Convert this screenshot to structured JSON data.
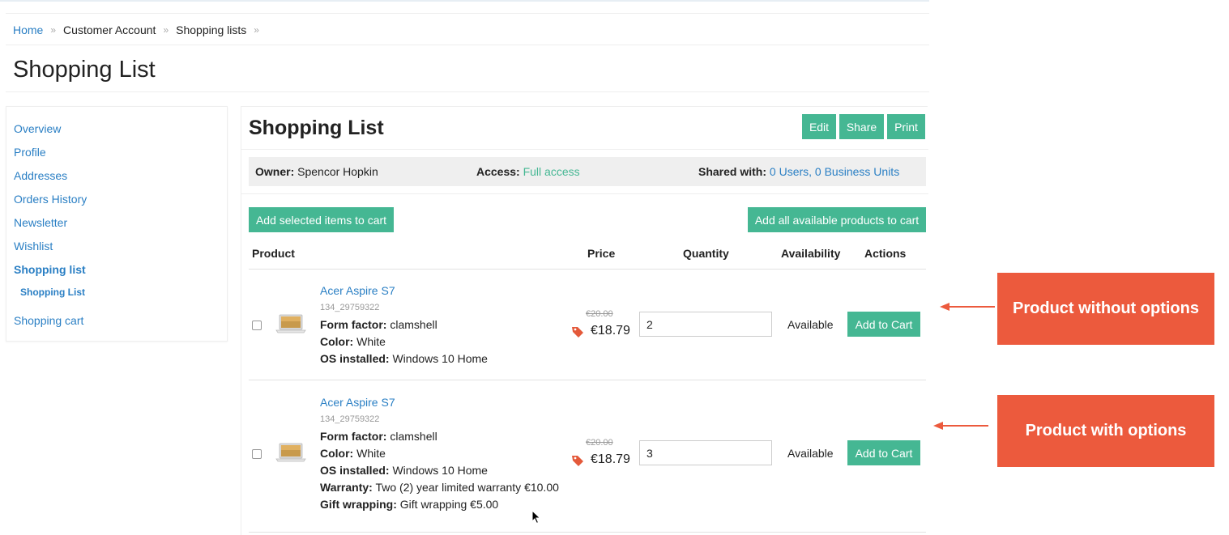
{
  "breadcrumb": [
    "Home",
    "Customer Account",
    "Shopping lists"
  ],
  "page_title": "Shopping List",
  "sidebar": {
    "items": [
      "Overview",
      "Profile",
      "Addresses",
      "Orders History",
      "Newsletter",
      "Wishlist",
      "Shopping list"
    ],
    "sub_item": "Shopping List",
    "last_item": "Shopping cart"
  },
  "panel": {
    "title": "Shopping List",
    "buttons": {
      "edit": "Edit",
      "share": "Share",
      "print": "Print"
    },
    "owner_label": "Owner:",
    "owner_value": "Spencor Hopkin",
    "access_label": "Access:",
    "access_value": "Full access",
    "shared_label": "Shared with:",
    "shared_users": "0 Users",
    "shared_comma": ",",
    "shared_units": "0 Business Units",
    "add_selected": "Add selected items to cart",
    "add_all": "Add all available products to cart",
    "columns": {
      "product": "Product",
      "price": "Price",
      "quantity": "Quantity",
      "availability": "Availability",
      "actions": "Actions"
    }
  },
  "products": [
    {
      "name": "Acer Aspire S7",
      "sku": "134_29759322",
      "options": [
        {
          "label": "Form factor:",
          "value": "clamshell"
        },
        {
          "label": "Color:",
          "value": "White"
        },
        {
          "label": "OS installed:",
          "value": "Windows 10 Home"
        }
      ],
      "old_price": "€20.00",
      "price": "€18.79",
      "quantity": "2",
      "availability": "Available",
      "action": "Add to Cart"
    },
    {
      "name": "Acer Aspire S7",
      "sku": "134_29759322",
      "options": [
        {
          "label": "Form factor:",
          "value": "clamshell"
        },
        {
          "label": "Color:",
          "value": "White"
        },
        {
          "label": "OS installed:",
          "value": "Windows 10 Home"
        },
        {
          "label": "Warranty:",
          "value": "Two (2) year limited warranty €10.00"
        },
        {
          "label": "Gift wrapping:",
          "value": "Gift wrapping €5.00"
        }
      ],
      "old_price": "€20.00",
      "price": "€18.79",
      "quantity": "3",
      "availability": "Available",
      "action": "Add to Cart"
    }
  ],
  "callouts": {
    "without": "Product without options",
    "with": "Product with options"
  },
  "colors": {
    "accent": "#45b793",
    "link": "#2a7fc4",
    "callout": "#ec5a3d"
  }
}
